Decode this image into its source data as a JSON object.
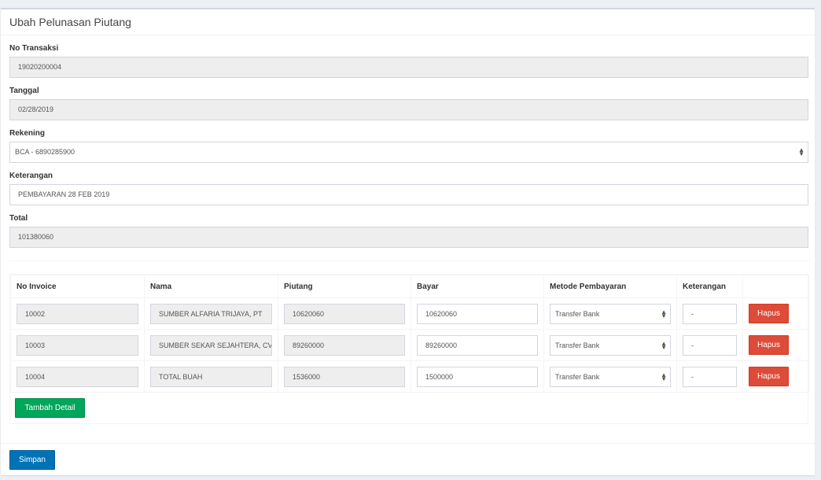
{
  "page": {
    "title": "Ubah Pelunasan Piutang"
  },
  "form": {
    "no_transaksi": {
      "label": "No Transaksi",
      "value": "19020200004"
    },
    "tanggal": {
      "label": "Tanggal",
      "value": "02/28/2019"
    },
    "rekening": {
      "label": "Rekening",
      "value": "BCA - 6890285900"
    },
    "keterangan": {
      "label": "Keterangan",
      "value": "PEMBAYARAN 28 FEB 2019"
    },
    "total": {
      "label": "Total",
      "value": "101380060"
    }
  },
  "detail": {
    "columns": [
      "No Invoice",
      "Nama",
      "Piutang",
      "Bayar",
      "Metode Pembayaran",
      "Keterangan",
      ""
    ],
    "rows": [
      {
        "no_invoice": "10002",
        "nama": "SUMBER ALFARIA TRIJAYA, PT",
        "piutang": "10620060",
        "bayar": "10620060",
        "metode": "Transfer Bank",
        "keterangan": "-",
        "delete_label": "Hapus"
      },
      {
        "no_invoice": "10003",
        "nama": "SUMBER SEKAR SEJAHTERA, CV",
        "piutang": "89260000",
        "bayar": "89260000",
        "metode": "Transfer Bank",
        "keterangan": "-",
        "delete_label": "Hapus"
      },
      {
        "no_invoice": "10004",
        "nama": "TOTAL BUAH",
        "piutang": "1536000",
        "bayar": "1500000",
        "metode": "Transfer Bank",
        "keterangan": "-",
        "delete_label": "Hapus"
      }
    ],
    "add_label": "Tambah Detail"
  },
  "footer": {
    "save_label": "Simpan"
  },
  "colors": {
    "danger": "#dd4b39",
    "success": "#00a65a",
    "primary": "#0073b7",
    "readonly_bg": "#eeeeee"
  }
}
